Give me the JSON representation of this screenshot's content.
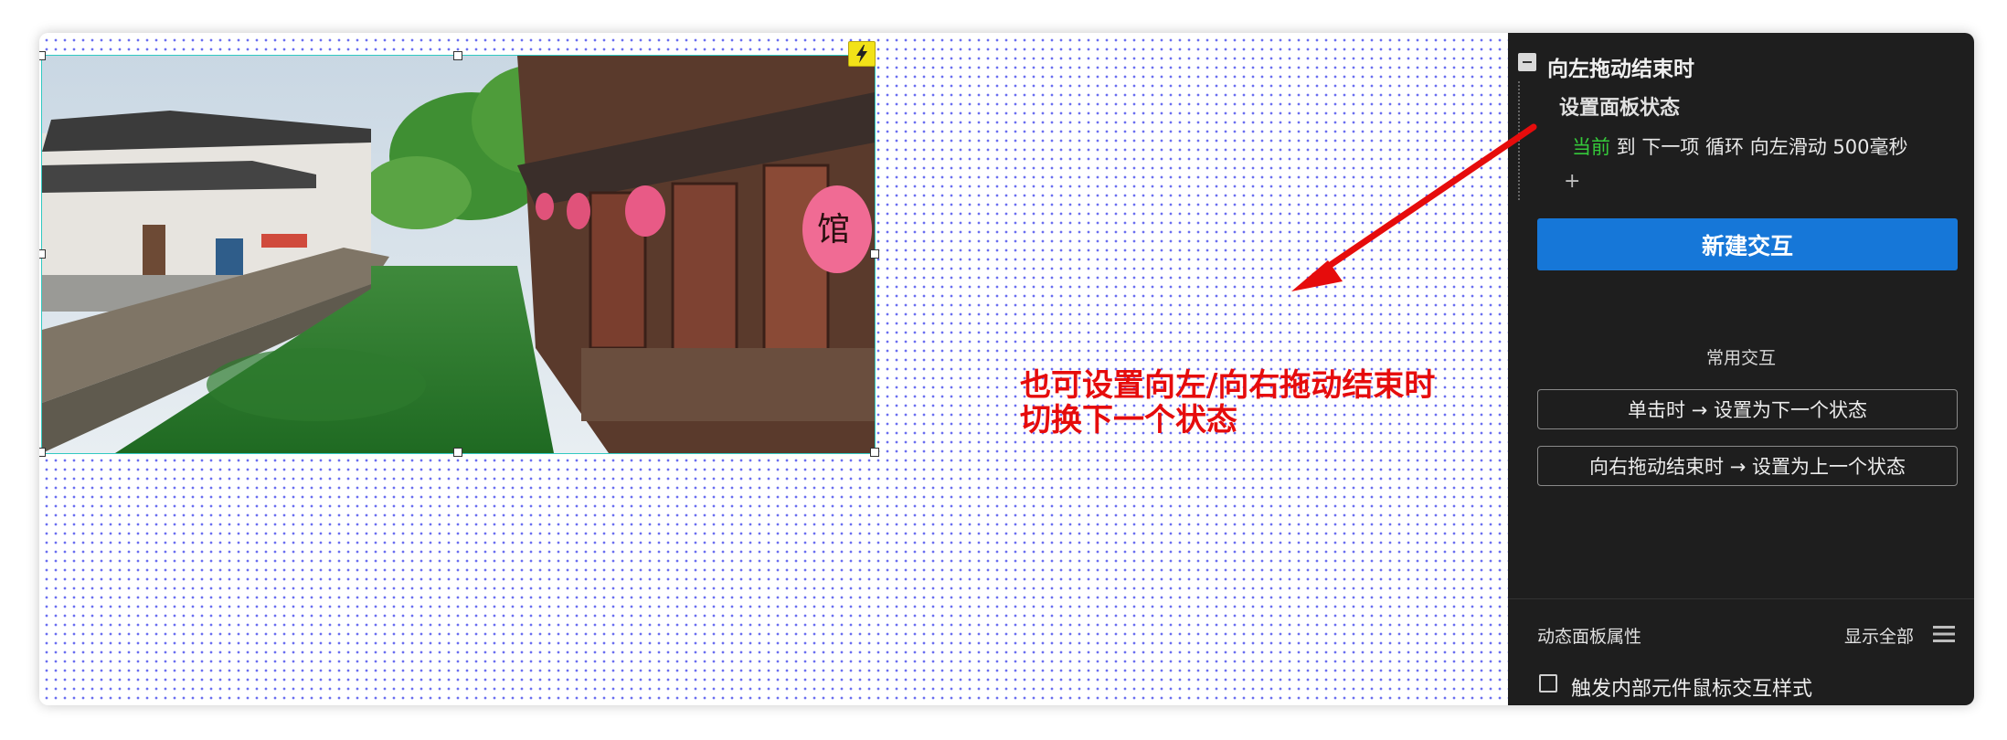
{
  "panel": {
    "event_title": "向左拖动结束时",
    "action_title": "设置面板状态",
    "action_detail": {
      "current": "当前",
      "rest": " 到 下一项 循环 向左滑动 500毫秒"
    },
    "add_symbol": "+",
    "new_interaction_button": "新建交互",
    "common_title": "常用交互",
    "presets": [
      "单击时 → 设置为下一个状态",
      "向右拖动结束时 → 设置为上一个状态"
    ],
    "properties_title": "动态面板属性",
    "show_all": "显示全部",
    "checkbox_label": "触发内部元件鼠标交互样式"
  },
  "canvas": {
    "annotation_lines": [
      "也可设置向左/向右拖动结束时",
      "切换下一个状态"
    ],
    "image_lantern_char": "馆"
  },
  "colors": {
    "panel_bg": "#1e1e1e",
    "primary_button": "#1677d8",
    "annotation": "#e60c0c",
    "current_highlight": "#35c93a",
    "selection_border": "#31c9c2",
    "grid_dot": "#6a6ef0",
    "interaction_badge": "#f2e218"
  },
  "icons": {
    "collapse": "minus-square-icon",
    "interaction_badge": "lightning-icon",
    "menu": "hamburger-menu-icon",
    "arrow": "red-arrow-annotation"
  }
}
